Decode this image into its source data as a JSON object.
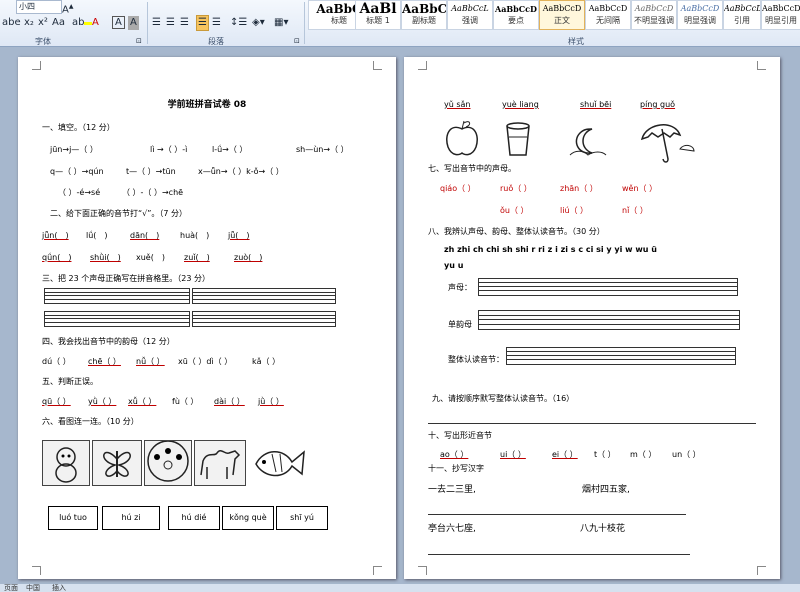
{
  "ribbon": {
    "font_size_value": "小四",
    "font_group_label": "字体",
    "paragraph_group_label": "段落",
    "styles_group_label": "样式",
    "styles": [
      {
        "sample": "AaBbC",
        "name": "标题"
      },
      {
        "sample": "AaBl",
        "name": "标题 1"
      },
      {
        "sample": "AaBbC",
        "name": "副标题"
      },
      {
        "sample": "AaBbCcL",
        "name": "强调"
      },
      {
        "sample": "AaBbCcD",
        "name": "要点"
      },
      {
        "sample": "AaBbCcD",
        "name": "正文"
      },
      {
        "sample": "AaBbCcD",
        "name": "无间隔"
      },
      {
        "sample": "AaBbCcD",
        "name": "不明显强调"
      },
      {
        "sample": "AaBbCcD",
        "name": "明显强调"
      },
      {
        "sample": "AaBbCcD",
        "name": "引用"
      },
      {
        "sample": "AaBbCcD",
        "name": "明显引用"
      }
    ]
  },
  "page1": {
    "title": "学前班拼音试卷 08",
    "s1": "一、填空。（12 分）",
    "s1_r1": [
      "jūn→j—（ ）",
      "lì →（ ）-ì",
      "l-ǘ→（ ）",
      "sh—ùn→（ ）"
    ],
    "s1_r2": [
      "q—（ ）→qún",
      "t—（ ）→tūn",
      "x—ǖn→（ ）k-ǒ→（ ）"
    ],
    "s1_r3": [
      "（ ）-é→sé",
      "（ ）-（ ）→chē"
    ],
    "s2": "二、给下面正确的音节打“√”。（7 分）",
    "s2_r1": [
      "jǖn(　)",
      "lǘ(　)",
      "dān(　)",
      "huà(　)",
      "jǖ(　)"
    ],
    "s2_r2": [
      "qǘn(　)",
      "shǜi(　)",
      "xuě(　)",
      "zuǐ(　)",
      "zuò(　)"
    ],
    "s3": "三、把 23 个声母正确写在拼音格里。（23 分）",
    "s4": "四、我会找出音节中的韵母（12 分）",
    "s4_r": [
      "dú（ ）",
      "chē（ ）",
      "nǚ（ ）",
      "xū（ ）dì（ ）",
      "kǎ（ ）"
    ],
    "s5": "五、判断正误。",
    "s5_r": [
      "qū（ ）",
      "yǜ（ ）",
      "xǚ（ ）",
      "fù（ ）",
      "dài（ ）",
      "jǜ（ ）"
    ],
    "s6": "六、看图连一连。（10 分）",
    "boxes": [
      "luó tuo",
      "hú zi",
      "hú dié",
      "kǒng què",
      "shī yú"
    ]
  },
  "page2": {
    "top_pinyin": [
      "yǔ sǎn",
      "yuè liang",
      "shuǐ bēi",
      "píng guǒ"
    ],
    "s7": "七、写出音节中的声母。",
    "s7_r1": [
      "qiáo（ ）",
      "ruǒ（ ）",
      "zhān（ ）",
      "wěn（ ）"
    ],
    "s7_r2": [
      "ǒu（ ）",
      "liú（ ）",
      "nǐ（ ）"
    ],
    "s8": "八、我辨认声母、韵母、整体认读音节。（30 分）",
    "s8_list": "zh  zhi  ch  chi  sh  shi  r  ri  z  i  zi  s  c  ci  si  y  yi  w  wu  ü",
    "s8_list2": "yu  u",
    "label_shengmu": "声母：",
    "label_danyunmu": "单韵母",
    "label_zhengti": "整体认读音节：",
    "s9": "九、请按顺序默写整体认读音节。（16）",
    "s10": "十、写出形近音节",
    "s10_r": [
      "ao（ ）",
      "ui（ ）",
      "ei（ ）",
      "t（ ）",
      "m（ ）",
      "un（ ）"
    ],
    "s11": "十一、抄写汉字",
    "copy1": "一去二三里,",
    "copy2": "烟村四五家,",
    "copy3": "亭台六七座,",
    "copy4": "八九十枝花"
  },
  "status": {
    "page_info": "页面",
    "lang": "中国",
    "mode": "插入"
  }
}
